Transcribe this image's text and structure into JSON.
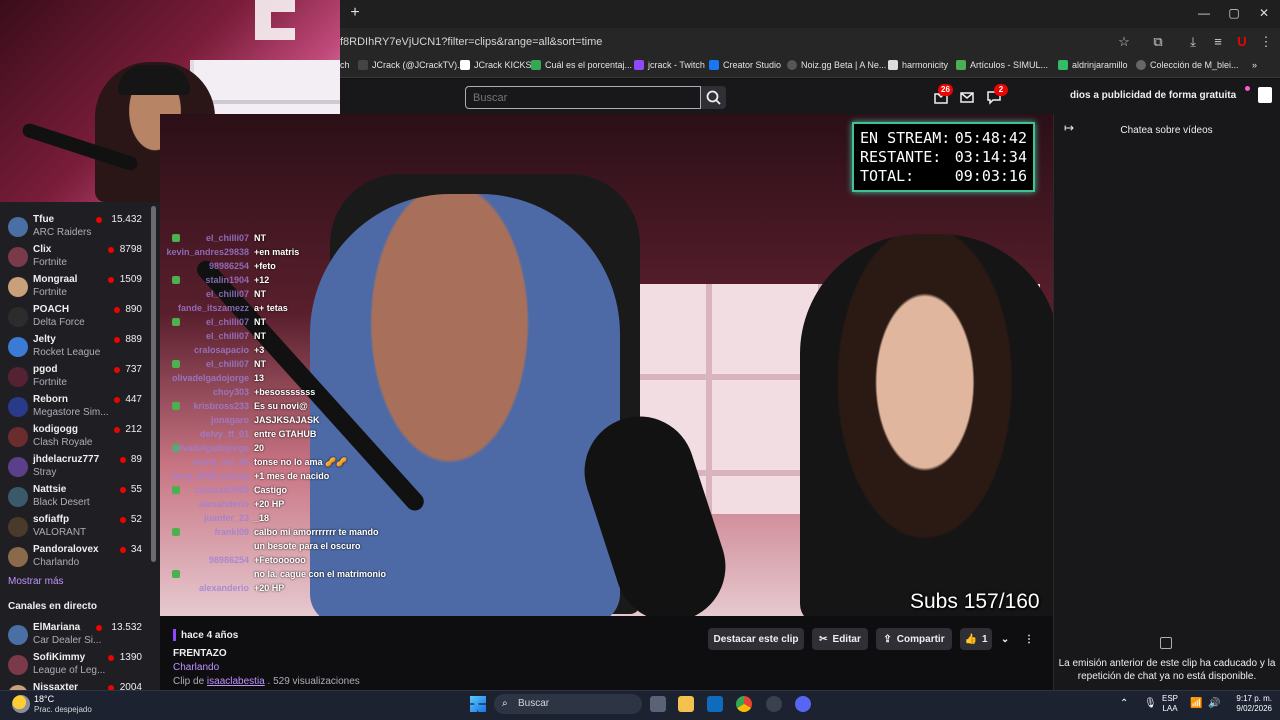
{
  "browser": {
    "url": "f8RDIhRY7eVjUCN1?filter=clips&range=all&sort=time",
    "new_tab": "+",
    "bookmarks": [
      "ch",
      "JCrack (@JCrackTV)...",
      "JCrack KICKS",
      "Cuál es el porcentaj...",
      "jcrack - Twitch",
      "Creator Studio",
      "Noiz.gg Beta | A Ne...",
      "harmonicity",
      "Artículos - SIMUL...",
      "aldrinjaramillo",
      "Colección de M_blei..."
    ],
    "bookmarks_more": "»"
  },
  "topnav": {
    "search_placeholder": "Buscar",
    "notif_count": "26",
    "whispers_count": "2",
    "promo": "dios a publicidad de forma gratuita"
  },
  "sidebar": {
    "channels": [
      {
        "name": "Tfue",
        "game": "ARC Raiders",
        "viewers": "15.432"
      },
      {
        "name": "Clix",
        "game": "Fortnite",
        "viewers": "8798"
      },
      {
        "name": "Mongraal",
        "game": "Fortnite",
        "viewers": "1509"
      },
      {
        "name": "POACH",
        "game": "Delta Force",
        "viewers": "890"
      },
      {
        "name": "Jelty",
        "game": "Rocket League",
        "viewers": "889"
      },
      {
        "name": "pgod",
        "game": "Fortnite",
        "viewers": "737"
      },
      {
        "name": "Reborn",
        "game": "Megastore Sim...",
        "viewers": "447"
      },
      {
        "name": "kodigogg",
        "game": "Clash Royale",
        "viewers": "212"
      },
      {
        "name": "jhdelacruz777",
        "game": "Stray",
        "viewers": "89"
      },
      {
        "name": "Nattsie",
        "game": "Black Desert",
        "viewers": "55"
      },
      {
        "name": "sofiaffp",
        "game": "VALORANT",
        "viewers": "52"
      },
      {
        "name": "Pandoralovex",
        "game": "Charlando",
        "viewers": "34"
      }
    ],
    "show_more": "Mostrar más",
    "live_heading": "Canales en directo",
    "live_channels": [
      {
        "name": "ElMariana",
        "game": "Car Dealer Si...",
        "viewers": "13.532"
      },
      {
        "name": "SofiKimmy",
        "game": "League of Leg...",
        "viewers": "1390"
      },
      {
        "name": "Nissaxter",
        "game": "",
        "viewers": "2004"
      }
    ]
  },
  "video": {
    "timer": [
      {
        "label": "EN STREAM:",
        "value": "05:48:42"
      },
      {
        "label": "RESTANTE:",
        "value": "03:14:34"
      },
      {
        "label": "TOTAL:",
        "value": "09:03:16"
      }
    ],
    "subs": "Subs 157/160",
    "chat": [
      {
        "user": "el_chilli07",
        "msg": "NT"
      },
      {
        "user": "kevin_andres29838",
        "msg": "+en matris"
      },
      {
        "user": "98986254",
        "msg": "+feto"
      },
      {
        "user": "stalin1904",
        "msg": "+12"
      },
      {
        "user": "el_chilli07",
        "msg": "NT"
      },
      {
        "user": "fande_itszamezz",
        "msg": "a+ tetas"
      },
      {
        "user": "el_chilli07",
        "msg": "NT"
      },
      {
        "user": "el_chilli07",
        "msg": "NT"
      },
      {
        "user": "cralosapacio",
        "msg": "+3"
      },
      {
        "user": "el_chilli07",
        "msg": "NT"
      },
      {
        "user": "olivadelgadojorge",
        "msg": "13"
      },
      {
        "user": "choy303",
        "msg": "+besosssssss"
      },
      {
        "user": "krisbross233",
        "msg": "Es su novi@"
      },
      {
        "user": "jonagaro",
        "msg": "JASJKSAJASK"
      },
      {
        "user": "delvy_ff_01",
        "msg": "entre GTAHUB"
      },
      {
        "user": "olivadelgadojorge",
        "msg": "20"
      },
      {
        "user": "david_val_69",
        "msg": "tonse no lo ama 🥜🥜"
      },
      {
        "user": "larry_2008_jaureg",
        "msg": "+1 mes de nacido"
      },
      {
        "user": "cevaran0095",
        "msg": "Castigo"
      },
      {
        "user": "alexanderio",
        "msg": "+20 HP"
      },
      {
        "user": "juanfer_23",
        "msg": "_18"
      },
      {
        "user": "frankl09",
        "msg": "calbo mi amorrrrrrr te mando"
      },
      {
        "user": "",
        "msg": "un besote para el oscuro"
      },
      {
        "user": "98986254",
        "msg": "+Fetoooooo"
      },
      {
        "user": "",
        "msg": "no la. cague con el matrimonio"
      },
      {
        "user": "alexanderio",
        "msg": "+20 HP"
      }
    ]
  },
  "clip": {
    "age": "hace 4 años",
    "title": "FRENTAZO",
    "category": "Charlando",
    "meta_prefix": "Clip de",
    "author": "isaaclabestia",
    "views": ". 529 visualizaciones",
    "feature_btn": "Destacar este clip",
    "edit_btn": "Editar",
    "share_btn": "Compartir",
    "likes": "1"
  },
  "right_panel": {
    "title": "Chatea sobre vídeos",
    "message": "La emisión anterior de este clip ha caducado y la repetición de chat ya no está disponible."
  },
  "taskbar": {
    "temp": "18°C",
    "weather": "Prac. despejado",
    "search": "Buscar",
    "lang1": "ESP",
    "lang2": "LAA",
    "time": "9:17 p. m.",
    "date": "9/02/2026"
  },
  "colors": {
    "accent": "#9147ff",
    "link": "#bf94ff",
    "live": "#eb0400",
    "timer_border": "#3fbf9a"
  }
}
